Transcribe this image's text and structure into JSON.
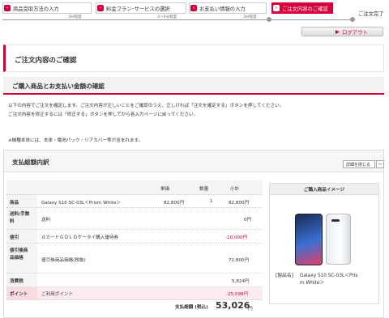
{
  "steps": [
    {
      "label": "商品受取方法の入力",
      "time": "3分程度"
    },
    {
      "label": "料金プラン･サービスの選択",
      "time": "3～5分程度"
    },
    {
      "label": "お支払い情報の入力",
      "time": "3分程度"
    },
    {
      "label": "ご注文内容のご確認",
      "time": ""
    }
  ],
  "step_done": "ご注文完了",
  "logout_label": "ログアウト",
  "page_title": "ご注文内容のご確認",
  "sub_title": "ご購入商品とお支払い金額の確認",
  "notice_lines": [
    "以下の内容でご注文を確定します。ご注文内容が正しいことをご確認のうえ、正しければ「注文を確定する」ボタンを押してください。",
    "ご注文内容を修正するには「修正する」ボタンを押してから各入力ページに戻ってください。",
    "※機種本体には、本体・電池パック・リアカバー等が含まれます。"
  ],
  "total": {
    "title": "支払総額内訳",
    "detail_close": "詳細を閉じる",
    "headers": {
      "price": "単価",
      "qty": "数量",
      "subtotal": "小計"
    },
    "rows": [
      {
        "label": "商品",
        "name": "Galaxy S10 SC-03L＜Prism White＞",
        "price": "82,800円",
        "qty": "1",
        "subtotal": "82,800円"
      },
      {
        "label": "送料/手数料",
        "name": "送料",
        "price": "",
        "qty": "",
        "subtotal": "0円"
      },
      {
        "label": "値引",
        "name": "ｄカードＧＯＬＤケータイ購入優待券",
        "price": "",
        "qty": "",
        "subtotal": "-10,000円"
      },
      {
        "label": "値引後商品価格",
        "name": "値引後商品価格(税抜)",
        "price": "",
        "qty": "",
        "subtotal": "72,800円"
      },
      {
        "label": "消費税",
        "name": "",
        "price": "",
        "qty": "",
        "subtotal": "5,824円"
      },
      {
        "label": "ポイント",
        "name": "ご利用ポイント",
        "price": "",
        "qty": "",
        "subtotal": "-25,598円"
      }
    ],
    "grand_label": "支払総額 (税込)",
    "grand_value": "53,026",
    "grand_unit": "円"
  },
  "image_box": {
    "title": "ご購入商品イメージ",
    "product_label": "[製品名]",
    "product_name_1": "Galaxy S10 SC-03L＜Pris",
    "product_name_2": "m White＞"
  },
  "colors": {
    "accent": "#d6003b"
  }
}
